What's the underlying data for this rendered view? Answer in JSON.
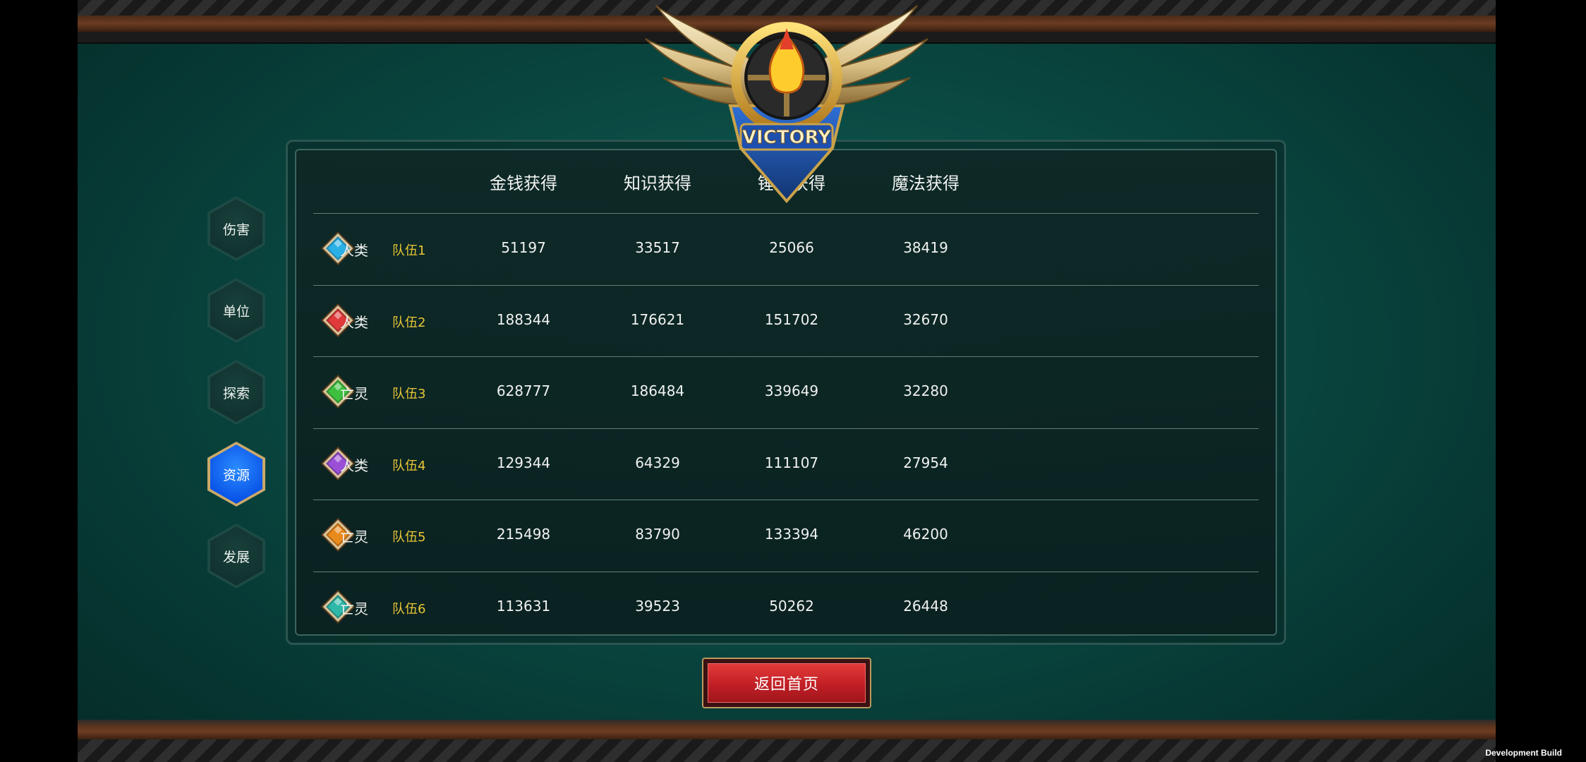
{
  "emblem": {
    "text": "VICTORY"
  },
  "side_tabs": [
    {
      "label": "伤害",
      "active": false
    },
    {
      "label": "单位",
      "active": false
    },
    {
      "label": "探索",
      "active": false
    },
    {
      "label": "资源",
      "active": true
    },
    {
      "label": "发展",
      "active": false
    }
  ],
  "table": {
    "headers": [
      "金钱获得",
      "知识获得",
      "锤子获得",
      "魔法获得"
    ],
    "rows": [
      {
        "gem_color": "#2ab0e6",
        "race": "人类",
        "team": "队伍1",
        "gold": "51197",
        "knowledge": "33517",
        "hammer": "25066",
        "magic": "38419"
      },
      {
        "gem_color": "#e03a3a",
        "race": "人类",
        "team": "队伍2",
        "gold": "188344",
        "knowledge": "176621",
        "hammer": "151702",
        "magic": "32670"
      },
      {
        "gem_color": "#3fbf3f",
        "race": "亡灵",
        "team": "队伍3",
        "gold": "628777",
        "knowledge": "186484",
        "hammer": "339649",
        "magic": "32280"
      },
      {
        "gem_color": "#9b4fd6",
        "race": "人类",
        "team": "队伍4",
        "gold": "129344",
        "knowledge": "64329",
        "hammer": "111107",
        "magic": "27954"
      },
      {
        "gem_color": "#e8891c",
        "race": "亡灵",
        "team": "队伍5",
        "gold": "215498",
        "knowledge": "83790",
        "hammer": "133394",
        "magic": "46200"
      },
      {
        "gem_color": "#2fb7a8",
        "race": "亡灵",
        "team": "队伍6",
        "gold": "113631",
        "knowledge": "39523",
        "hammer": "50262",
        "magic": "26448"
      }
    ]
  },
  "return_button": {
    "label": "返回首页"
  },
  "footer": {
    "build_label": "Development Build"
  }
}
